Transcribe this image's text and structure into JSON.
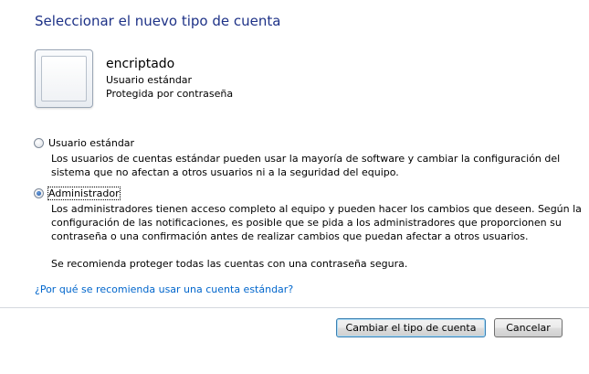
{
  "page": {
    "title": "Seleccionar el nuevo tipo de cuenta"
  },
  "account": {
    "name": "encriptado",
    "type": "Usuario estándar",
    "protection": "Protegida por contraseña"
  },
  "options": {
    "standard": {
      "label": "Usuario estándar",
      "checked": false,
      "description_lines": [
        "Los usuarios de cuentas estándar pueden usar la mayoría de software y cambiar la configuración del",
        "sistema que no afectan a otros usuarios ni a la seguridad del equipo."
      ]
    },
    "admin": {
      "label": "Administrador",
      "checked": true,
      "description_lines": [
        "Los administradores tienen acceso completo al equipo y pueden hacer los cambios que deseen. Según la",
        "configuración de las notificaciones, es posible que se pida a los administradores que proporcionen su",
        "contraseña o una confirmación antes de realizar cambios que puedan afectar a otros usuarios."
      ],
      "recommendation": "Se recomienda proteger todas las cuentas con una contraseña segura."
    }
  },
  "help_link": "¿Por qué se recomienda usar una cuenta estándar?",
  "buttons": {
    "change_type": "Cambiar el tipo de cuenta",
    "cancel": "Cancelar"
  },
  "colors": {
    "title": "#1e3287",
    "link": "#0066cc"
  }
}
